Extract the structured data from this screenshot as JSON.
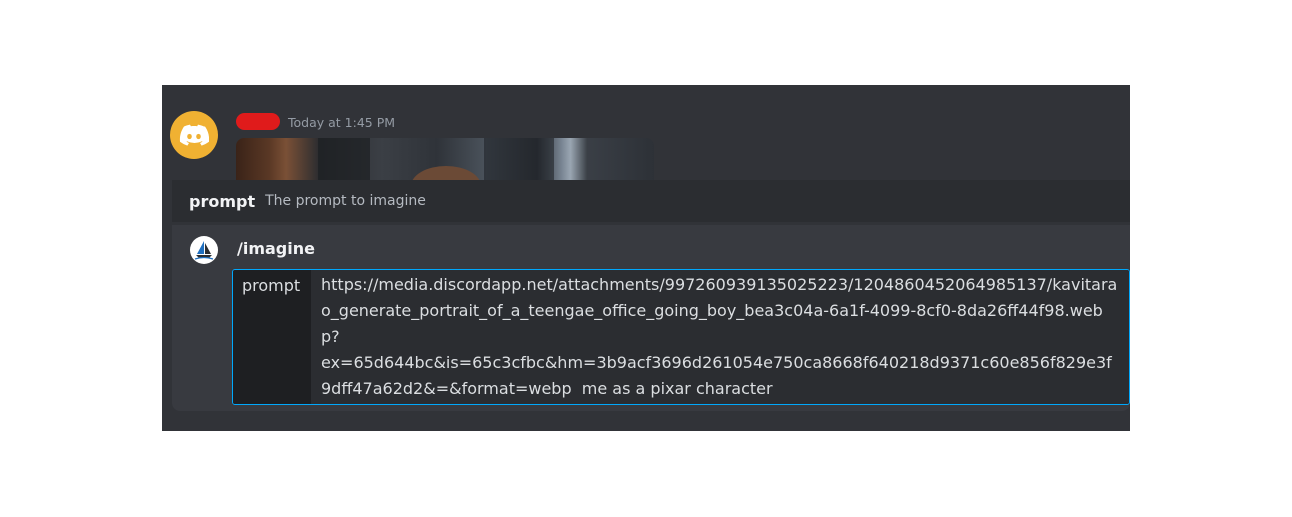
{
  "message": {
    "timestamp": "Today at 1:45 PM",
    "avatar_icon": "discord-logo-icon",
    "avatar_color": "#f0b132"
  },
  "command_option": {
    "name": "prompt",
    "description": "The prompt to imagine"
  },
  "command": {
    "name": "/imagine",
    "bot_icon": "sailboat-icon",
    "parameter_label": "prompt",
    "parameter_value": "https://media.discordapp.net/attachments/997260939135025223/1204860452064985137/kavitarao_generate_portrait_of_a_teengae_office_going_boy_bea3c04a-6a1f-4099-8cf0-8da26ff44f98.webp?\nex=65d644bc&is=65c3cfbc&hm=3b9acf3696d261054e750ca8668f640218d9371c60e856f829e3f9dff47a62d2&=&format=webp  me as a pixar character"
  },
  "colors": {
    "background": "#313338",
    "accent_focus": "#00a8fc"
  }
}
